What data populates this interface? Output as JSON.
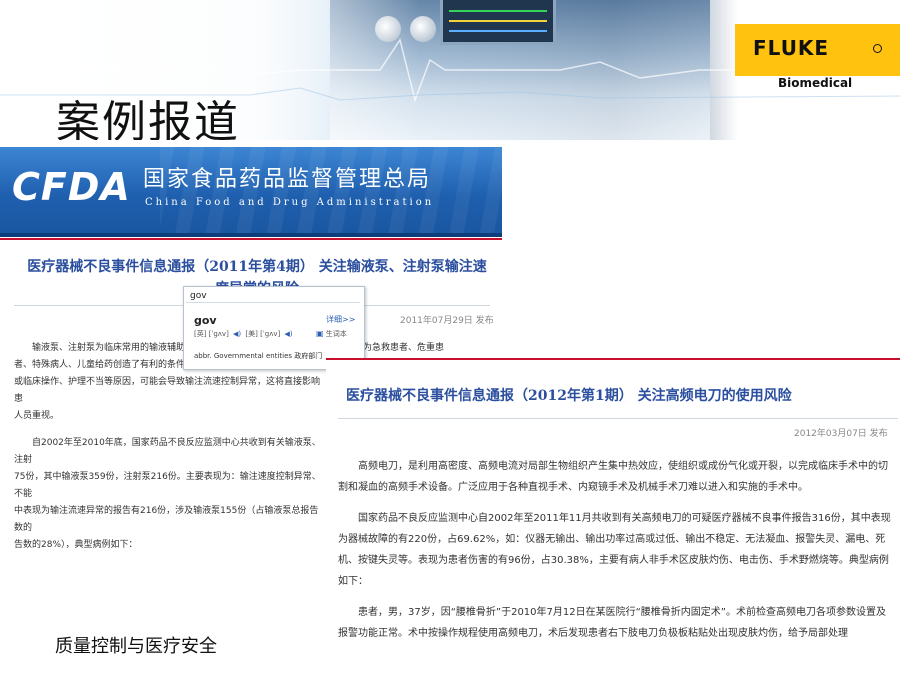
{
  "slide": {
    "title": "案例报道",
    "caption": "质量控制与医疗安全"
  },
  "brand": {
    "logo_name": "FLUKE",
    "logo_mark": "®",
    "logo_sub": "Biomedical",
    "logo_color": "#ffc20e"
  },
  "cfda": {
    "logo": "CFDA",
    "name_cn": "国家食品药品监督管理总局",
    "name_en": "China Food and Drug Administration",
    "banner_color": "#1e5fae"
  },
  "article1": {
    "headline": "医疗器械不良事件信息通报（2011年第4期） 关注输液泵、注射泵输注速度异常的风险",
    "date": "2011年07月29日  发布",
    "paragraphs": [
      "输液泵、注射泵为临床常用的输液辅助设备",
      "者、特殊病人、儿童给药创造了有利的条件，",
      "或临床操作、护理不当等原因，可能会导致输注流速控制异常，这将直接影响患",
      "人员重视。",
      "自2002年至2010年底，国家药品不良反应监测中心共收到有关输液泵、注射",
      "75份，其中输液泵359份，注射泵216份。主要表现为：输注速度控制异常、不能",
      "中表现为输注流速异常的报告有216份，涉及输液泵155份（占输液泵总报告数的",
      "告数的28%），典型病例如下："
    ],
    "right_fragment": "药物。为急救患者、危重患"
  },
  "dict_popup": {
    "search_value": "gov",
    "word": "gov",
    "more_link": "详细>>",
    "phonetic_uk": "[英] [ˈgʌv]",
    "phonetic_us": "[美] [ˈgʌv]",
    "wordbook": "生词本",
    "definition": "abbr.  Governmental entities 政府部门"
  },
  "article2": {
    "headline": "医疗器械不良事件信息通报（2012年第1期） 关注高频电刀的使用风险",
    "date": "2012年03月07日  发布",
    "paragraphs": [
      "高频电刀，是利用高密度、高频电流对局部生物组织产生集中热效应，使组织或成份气化或开裂，以完成临床手术中的切割和凝血的高频手术设备。广泛应用于各种直视手术、内窥镜手术及机械手术刀难以进入和实施的手术中。",
      "国家药品不良反应监测中心自2002年至2011年11月共收到有关高频电刀的可疑医疗器械不良事件报告316份，其中表现为器械故障的有220份，占69.62%，如：仪器无输出、输出功率过高或过低、输出不稳定、无法凝血、报警失灵、漏电、死机、按键失灵等。表现为患者伤害的有96份，占30.38%，主要有病人非手术区皮肤灼伤、电击伤、手术野燃烧等。典型病例如下：",
      "患者，男，37岁，因“腰椎骨折”于2010年7月12日在某医院行“腰椎骨折内固定术”。术前检查高频电刀各项参数设置及报警功能正常。术中按操作规程使用高频电刀，术后发现患者右下肢电刀负极板粘贴处出现皮肤灼伤，给予局部处理"
    ]
  }
}
